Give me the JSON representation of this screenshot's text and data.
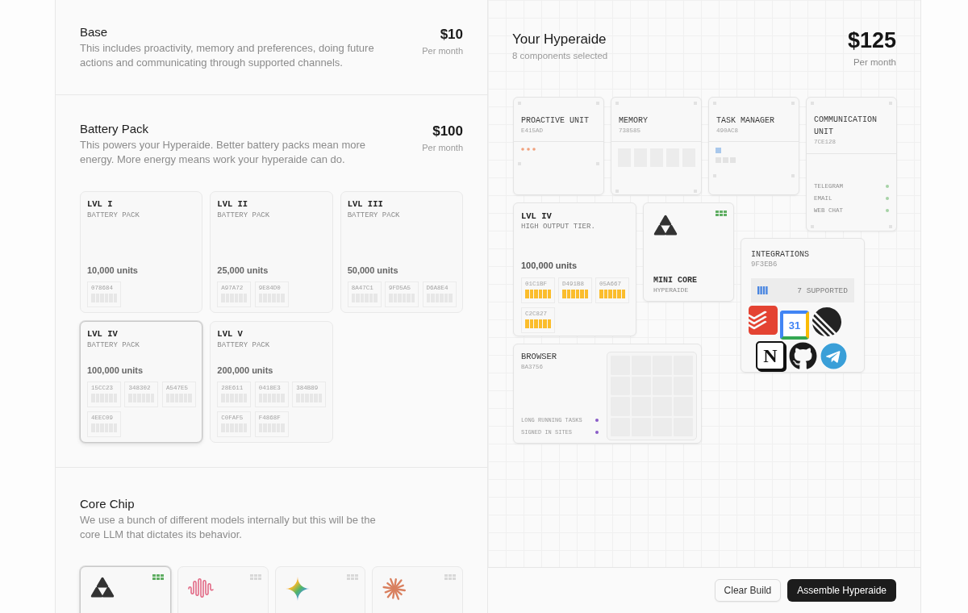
{
  "sections": [
    {
      "kind": "base",
      "title": "Base",
      "description": "This includes proactivity, memory and preferences, doing future actions and communicating through supported channels.",
      "price": "$10",
      "period": "Per month"
    },
    {
      "kind": "battery",
      "title": "Battery Pack",
      "description": "This powers your Hyperaide. Better battery packs mean more energy. More energy means work your hyperaide can do.",
      "price": "$100",
      "period": "Per month",
      "options": [
        {
          "level": "LVL I",
          "subtitle": "BATTERY PACK",
          "capacity": "10,000 units",
          "selected": false,
          "cells": [
            "078684"
          ]
        },
        {
          "level": "LVL II",
          "subtitle": "BATTERY PACK",
          "capacity": "25,000 units",
          "selected": false,
          "cells": [
            "A97A72",
            "9E84D0"
          ]
        },
        {
          "level": "LVL III",
          "subtitle": "BATTERY PACK",
          "capacity": "50,000 units",
          "selected": false,
          "cells": [
            "8A47C1",
            "9FD5A5",
            "D6A8E4"
          ]
        },
        {
          "level": "LVL IV",
          "subtitle": "BATTERY PACK",
          "capacity": "100,000 units",
          "selected": true,
          "cells": [
            "15CC23",
            "348302",
            "A547E5",
            "4EEC09"
          ]
        },
        {
          "level": "LVL V",
          "subtitle": "BATTERY PACK",
          "capacity": "200,000 units",
          "selected": false,
          "cells": [
            "28E611",
            "0418E3",
            "384B89",
            "C0FAF5",
            "F4868F"
          ]
        }
      ]
    },
    {
      "kind": "core",
      "title": "Core Chip",
      "description": "We use a bunch of different models internally but this will be the core LLM that dictates its behavior.",
      "options": [
        {
          "kind": "trefoil",
          "selected": true
        },
        {
          "kind": "wave",
          "selected": false
        },
        {
          "kind": "sparkle",
          "selected": false
        },
        {
          "kind": "asterisk",
          "selected": false
        }
      ]
    }
  ],
  "build": {
    "title": "Your Hyperaide",
    "subtitle": "8 components selected",
    "price": "$125",
    "period": "Per month",
    "components": [
      {
        "kind": "proactive",
        "title": "PROACTIVE UNIT",
        "code": "E415AD"
      },
      {
        "kind": "memory",
        "title": "MEMORY",
        "code": "738585"
      },
      {
        "kind": "tasks",
        "title": "TASK MANAGER",
        "code": "490AC8"
      },
      {
        "kind": "channels",
        "title": "COMMUNICATION UNIT",
        "code": "7CE128",
        "channels": [
          "TELEGRAM",
          "EMAIL",
          "WEB CHAT"
        ]
      },
      {
        "kind": "battery",
        "title": "LVL IV",
        "subtitle": "HIGH OUTPUT TIER.",
        "capacity": "100,000 units",
        "cells": [
          "01C1BF",
          "D491B8",
          "05A667",
          "C2C827"
        ]
      },
      {
        "kind": "core",
        "logo": {
          "kind": "trefoil"
        },
        "title": "MINI CORE",
        "subtitle": "HYPERAIDE"
      },
      {
        "kind": "integrations",
        "title": "INTEGRATIONS",
        "code": "9F3EB6",
        "count": "7 SUPPORTED",
        "logos": [
          {
            "kind": "chevrons"
          },
          {
            "kind": "calendar",
            "text": "31"
          },
          {
            "kind": "stripes"
          },
          {
            "kind": "letter",
            "text": "N"
          },
          {
            "kind": "cat"
          },
          {
            "kind": "plane"
          }
        ]
      },
      {
        "kind": "browser",
        "title": "BROWSER",
        "code": "BA3756",
        "features": [
          "LONG RUNNING TASKS",
          "SIGNED IN SITES"
        ]
      }
    ],
    "buttons": [
      {
        "label": "Clear Build",
        "kind": "secondary"
      },
      {
        "label": "Assemble Hyperaide",
        "kind": "primary"
      }
    ]
  }
}
